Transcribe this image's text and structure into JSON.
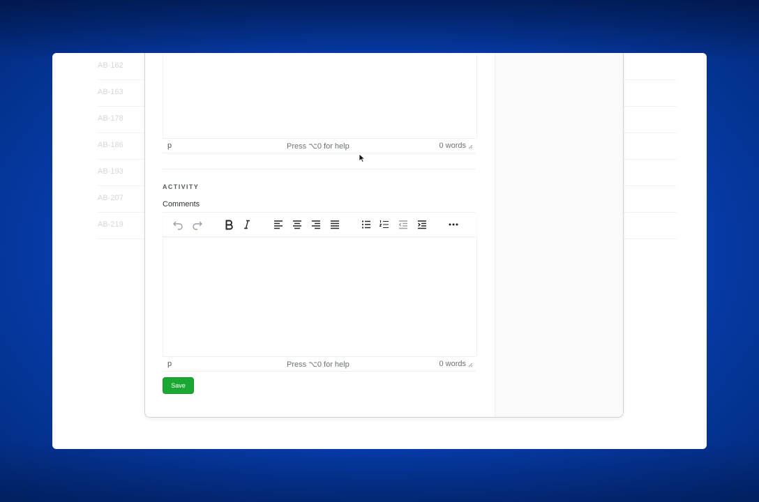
{
  "background_list": {
    "rows": [
      "AB-162",
      "AB-163",
      "AB-178",
      "AB-186",
      "AB-193",
      "AB-207",
      "AB-219"
    ]
  },
  "description_editor": {
    "status_path": "p",
    "status_help": "Press ⌥0 for help",
    "word_count": "0 words"
  },
  "activity": {
    "section_title": "ACTIVITY",
    "comments_label": "Comments",
    "toolbar": {
      "icons": [
        "undo-icon",
        "redo-icon",
        "bold-icon",
        "italic-icon",
        "align-left-icon",
        "align-center-icon",
        "align-right-icon",
        "align-justify-icon",
        "bullet-list-icon",
        "numbered-list-icon",
        "outdent-icon",
        "indent-icon",
        "more-icon"
      ]
    },
    "comment_editor": {
      "status_path": "p",
      "status_help": "Press ⌥0 for help",
      "word_count": "0 words"
    },
    "save_label": "Save"
  },
  "colors": {
    "backdrop": "#0741b8",
    "save_button": "#1aa832"
  }
}
